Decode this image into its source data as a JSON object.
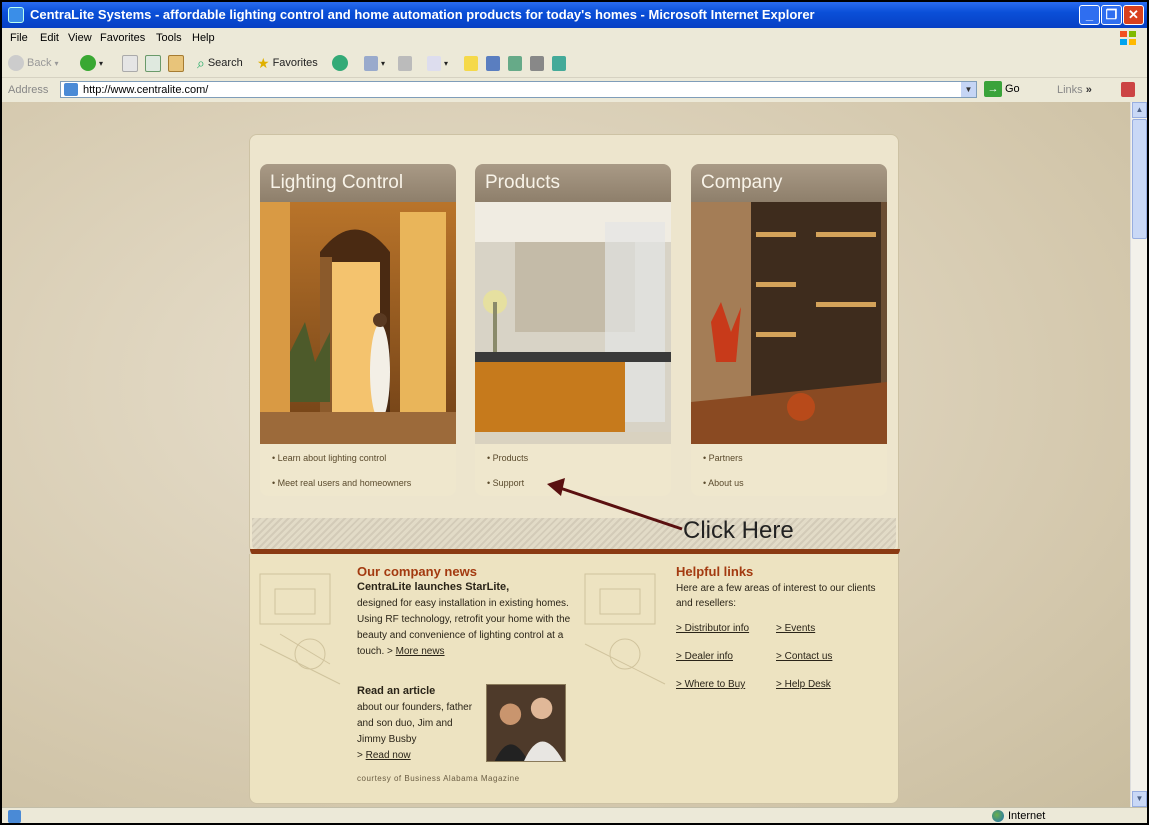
{
  "window": {
    "title": "CentraLite Systems - affordable lighting control and home automation products for today's homes - Microsoft Internet Explorer"
  },
  "menu": [
    "File",
    "Edit",
    "View",
    "Favorites",
    "Tools",
    "Help"
  ],
  "toolbar": {
    "back": "Back",
    "search": "Search",
    "favorites": "Favorites"
  },
  "address": {
    "label": "Address",
    "url": "http://www.centralite.com/",
    "go": "Go",
    "links": "Links"
  },
  "panels": [
    {
      "title": "Lighting Control",
      "links": [
        "• Learn about lighting control",
        "• Meet real users and homeowners"
      ]
    },
    {
      "title": "Products",
      "links": [
        "• Products",
        "• Support"
      ]
    },
    {
      "title": "Company",
      "links": [
        "• Partners",
        "• About us"
      ]
    }
  ],
  "annotation": "Click Here",
  "news": {
    "heading": "Our company news",
    "headline": "CentraLite launches StarLite,",
    "body": "designed for easy installation in existing homes. Using RF technology, retrofit your home with the beauty and convenience of lighting control at a touch. >",
    "more": "More news",
    "article_heading": "Read an article",
    "article_body": "about our founders, father and son duo, Jim and Jimmy Busby",
    "read_prefix": ">",
    "read_now": "Read now",
    "courtesy": "courtesy of Business Alabama Magazine"
  },
  "helpful": {
    "heading": "Helpful links",
    "body": "Here are a few areas of interest to our clients and resellers:",
    "links": [
      {
        "label": "> Distributor info"
      },
      {
        "label": "> Events"
      },
      {
        "label": "> Dealer info"
      },
      {
        "label": "> Contact us"
      },
      {
        "label": "> Where to Buy"
      },
      {
        "label": "> Help Desk"
      }
    ]
  },
  "status": {
    "zone": "Internet"
  }
}
